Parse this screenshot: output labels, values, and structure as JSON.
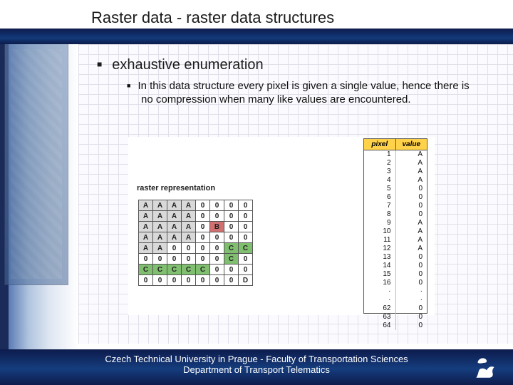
{
  "title": "Raster data - raster data structures",
  "bullet1": "exhaustive enumeration",
  "bullet2": "In this data structure every pixel is given a single value, hence there is no compression when many like values are encountered.",
  "figure": {
    "label": "raster representation",
    "grid": [
      [
        "A",
        "A",
        "A",
        "A",
        "0",
        "0",
        "0",
        "0"
      ],
      [
        "A",
        "A",
        "A",
        "A",
        "0",
        "0",
        "0",
        "0"
      ],
      [
        "A",
        "A",
        "A",
        "A",
        "0",
        "B",
        "0",
        "0"
      ],
      [
        "A",
        "A",
        "A",
        "A",
        "0",
        "0",
        "0",
        "0"
      ],
      [
        "A",
        "A",
        "0",
        "0",
        "0",
        "0",
        "C",
        "C"
      ],
      [
        "0",
        "0",
        "0",
        "0",
        "0",
        "0",
        "C",
        "0"
      ],
      [
        "C",
        "C",
        "C",
        "C",
        "C",
        "0",
        "0",
        "0"
      ],
      [
        "0",
        "0",
        "0",
        "0",
        "0",
        "0",
        "0",
        "D"
      ]
    ],
    "classMap": {
      "A": "ca",
      "B": "cb",
      "C": "cc",
      "D": "cd",
      "0": "cd"
    }
  },
  "pixel_table": {
    "header": [
      "pixel",
      "value"
    ],
    "rows_top": [
      [
        "1",
        "A"
      ],
      [
        "2",
        "A"
      ],
      [
        "3",
        "A"
      ],
      [
        "4",
        "A"
      ],
      [
        "5",
        "0"
      ],
      [
        "6",
        "0"
      ],
      [
        "7",
        "0"
      ],
      [
        "8",
        "0"
      ],
      [
        "9",
        "A"
      ],
      [
        "10",
        "A"
      ],
      [
        "11",
        "A"
      ],
      [
        "12",
        "A"
      ],
      [
        "13",
        "0"
      ],
      [
        "14",
        "0"
      ],
      [
        "15",
        "0"
      ],
      [
        "16",
        "0"
      ]
    ],
    "rows_bottom": [
      [
        "62",
        "0"
      ],
      [
        "63",
        "0"
      ],
      [
        "64",
        "0"
      ]
    ]
  },
  "footer": {
    "line1": "Czech Technical University in Prague - Faculty of Transportation Sciences",
    "line2": "Department of Transport Telematics"
  }
}
